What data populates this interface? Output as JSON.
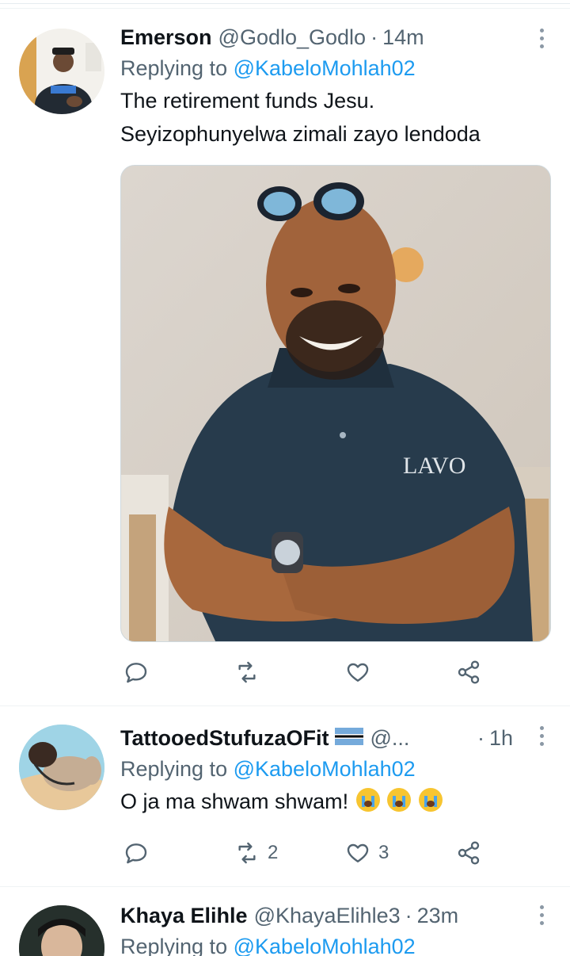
{
  "tweets": [
    {
      "name": "Emerson",
      "handle": "@Godlo_Godlo",
      "time": "14m",
      "replying_label": "Replying to",
      "replying_to": "@KabeloMohlah02",
      "text_lines": [
        "The retirement funds Jesu.",
        "Seyizophunyelwa zimali zayo lendoda"
      ],
      "media_shirt_text": "LAVO",
      "reply_count": "",
      "retweet_count": "",
      "like_count": ""
    },
    {
      "name": "TattooedStufuzaOFit",
      "handle": "@...",
      "time": "1h",
      "replying_label": "Replying to",
      "replying_to": "@KabeloMohlah02",
      "text": "O ja ma shwam shwam!",
      "reply_count": "",
      "retweet_count": "2",
      "like_count": "3"
    },
    {
      "name": "Khaya Elihle",
      "handle": "@KhayaElihle3",
      "time": "23m",
      "replying_label": "Replying to",
      "replying_to": "@KabeloMohlah02"
    }
  ],
  "icons": {
    "reply": "reply-icon",
    "retweet": "retweet-icon",
    "like": "heart-icon",
    "share": "share-icon",
    "more": "more-options-icon",
    "flag": "botswana-flag-icon",
    "emoji": "loudly-crying-face-icon"
  },
  "colors": {
    "text": "#0f1419",
    "secondary": "#536471",
    "link": "#1d9bf0",
    "divider": "#eff3f4"
  }
}
